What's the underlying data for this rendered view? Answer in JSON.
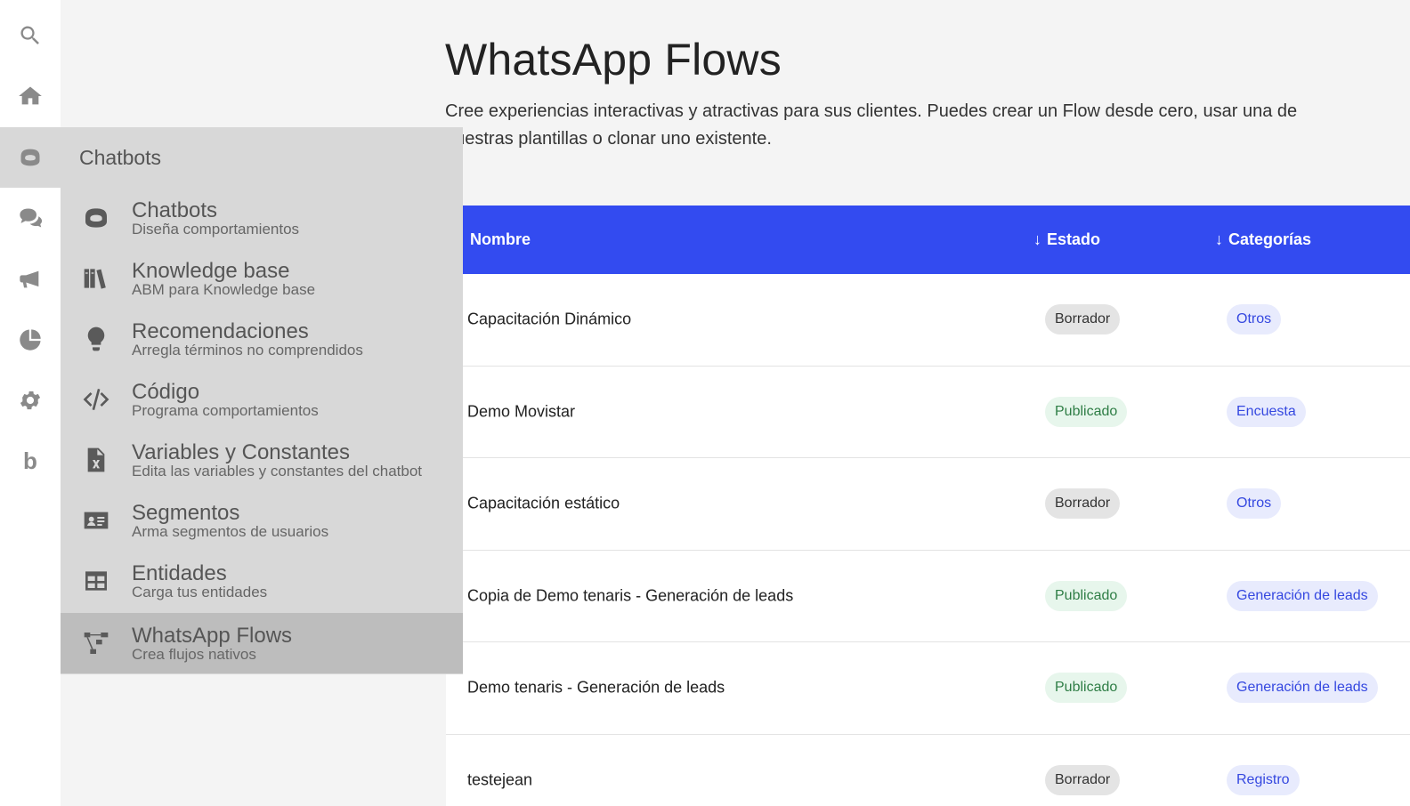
{
  "rail": {
    "items": [
      {
        "icon": "search-icon"
      },
      {
        "icon": "home-icon"
      },
      {
        "icon": "robot-icon",
        "active": true
      },
      {
        "icon": "chat-icon"
      },
      {
        "icon": "megaphone-icon"
      },
      {
        "icon": "pie-chart-icon"
      },
      {
        "icon": "gear-icon"
      },
      {
        "icon": "b-logo-icon",
        "letter": "b"
      }
    ]
  },
  "page": {
    "title": "WhatsApp Flows",
    "description": "Cree experiencias interactivas y atractivas para sus clientes. Puedes crear un Flow desde cero, usar una de nuestras plantillas o clonar uno existente."
  },
  "table": {
    "columns": [
      {
        "label": "Nombre",
        "sort": "↓"
      },
      {
        "label": "Estado",
        "sort": "↓"
      },
      {
        "label": "Categorías",
        "sort": "↓"
      }
    ],
    "rows": [
      {
        "name": "Capacitación Dinámico",
        "state": "Borrador",
        "category": "Otros"
      },
      {
        "name": "Demo Movistar",
        "state": "Publicado",
        "category": "Encuesta"
      },
      {
        "name": "Capacitación estático",
        "state": "Borrador",
        "category": "Otros"
      },
      {
        "name": "Copia de Demo tenaris - Generación de leads",
        "state": "Publicado",
        "category": "Generación de leads"
      },
      {
        "name": "Demo tenaris - Generación de leads",
        "state": "Publicado",
        "category": "Generación de leads"
      },
      {
        "name": "testejean",
        "state": "Borrador",
        "category": "Registro"
      }
    ]
  },
  "submenu": {
    "header": "Chatbots",
    "items": [
      {
        "title": "Chatbots",
        "subtitle": "Diseña comportamientos",
        "icon": "robot-icon"
      },
      {
        "title": "Knowledge base",
        "subtitle": "ABM para Knowledge base",
        "icon": "books-icon"
      },
      {
        "title": "Recomendaciones",
        "subtitle": "Arregla términos no comprendidos",
        "icon": "lightbulb-icon"
      },
      {
        "title": "Código",
        "subtitle": "Programa comportamientos",
        "icon": "code-icon"
      },
      {
        "title": "Variables y Constantes",
        "subtitle": "Edita las variables y constantes del chatbot",
        "icon": "variable-file-icon"
      },
      {
        "title": "Segmentos",
        "subtitle": "Arma segmentos de usuarios",
        "icon": "id-card-icon"
      },
      {
        "title": "Entidades",
        "subtitle": "Carga tus entidades",
        "icon": "table-icon"
      },
      {
        "title": "WhatsApp Flows",
        "subtitle": "Crea flujos nativos",
        "icon": "flow-icon",
        "active": true
      }
    ]
  },
  "colors": {
    "table_header": "#334bf0",
    "published_text": "#2e7d45",
    "published_bg": "#e7f6ec",
    "draft_bg": "#e4e4e4",
    "category_bg": "#e8ebfd",
    "category_text": "#3548e0"
  }
}
